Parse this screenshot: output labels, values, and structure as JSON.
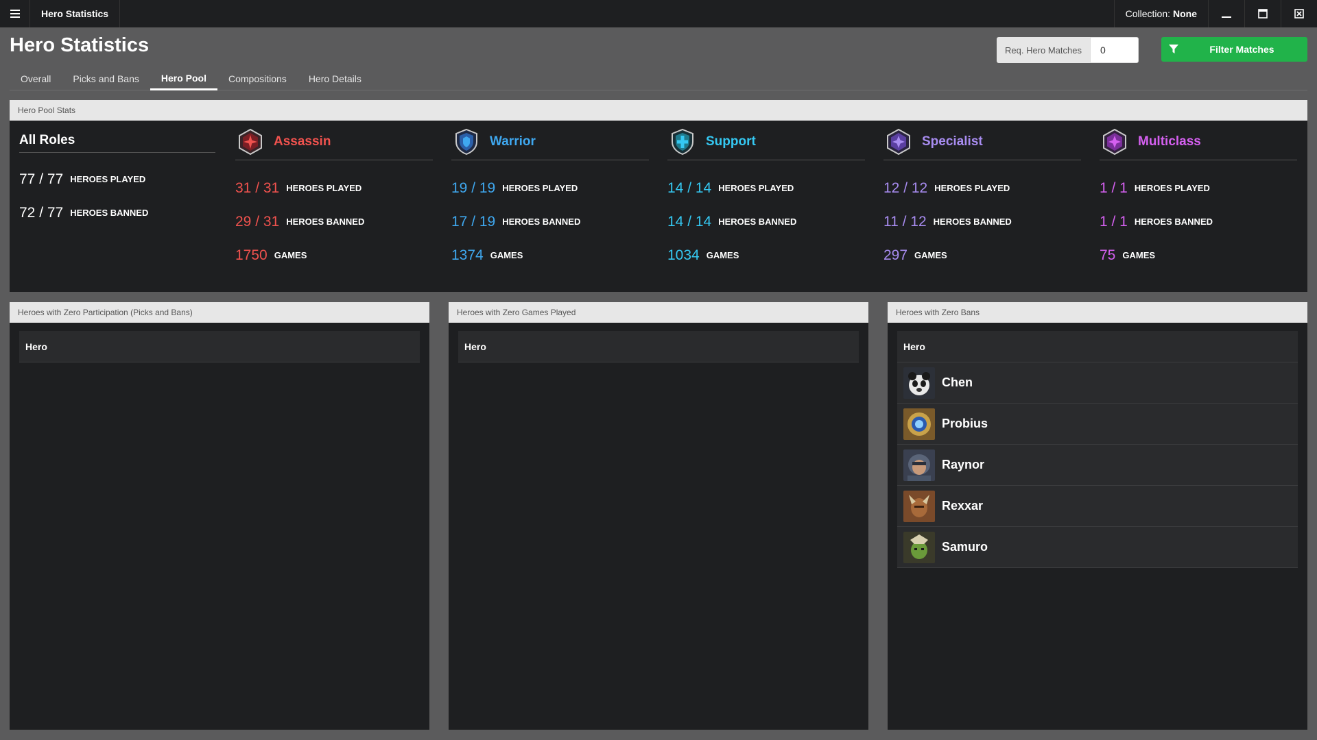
{
  "window": {
    "title": "Hero Statistics",
    "collection_label": "Collection:",
    "collection_value": "None"
  },
  "page": {
    "title": "Hero Statistics",
    "tabs": [
      {
        "label": "Overall"
      },
      {
        "label": "Picks and Bans"
      },
      {
        "label": "Hero Pool"
      },
      {
        "label": "Compositions"
      },
      {
        "label": "Hero Details"
      }
    ],
    "active_tab": "Hero Pool",
    "req_label": "Req. Hero Matches",
    "req_value": "0",
    "filter_label": "Filter Matches"
  },
  "stats_panel": {
    "title": "Hero Pool Stats",
    "all_roles": {
      "title": "All Roles",
      "played": "77 / 77",
      "played_label": "HEROES PLAYED",
      "banned": "72 / 77",
      "banned_label": "HEROES BANNED"
    },
    "roles": [
      {
        "name": "Assassin",
        "color": "#f0524e",
        "icon": "assassin-icon",
        "played": "31 / 31",
        "banned": "29 / 31",
        "games": "1750"
      },
      {
        "name": "Warrior",
        "color": "#3fa8f0",
        "icon": "warrior-icon",
        "played": "19 / 19",
        "banned": "17 / 19",
        "games": "1374"
      },
      {
        "name": "Support",
        "color": "#35c8f2",
        "icon": "support-icon",
        "played": "14 / 14",
        "banned": "14 / 14",
        "games": "1034"
      },
      {
        "name": "Specialist",
        "color": "#a88cf0",
        "icon": "specialist-icon",
        "played": "12 / 12",
        "banned": "11 / 12",
        "games": "297"
      },
      {
        "name": "Multiclass",
        "color": "#d560f0",
        "icon": "multiclass-icon",
        "played": "1 / 1",
        "banned": "1 / 1",
        "games": "75"
      }
    ],
    "labels": {
      "played": "HEROES PLAYED",
      "banned": "HEROES BANNED",
      "games": "GAMES"
    }
  },
  "zero_participation": {
    "title": "Heroes with Zero Participation (Picks and Bans)",
    "column": "Hero",
    "rows": []
  },
  "zero_games": {
    "title": "Heroes with Zero Games Played",
    "column": "Hero",
    "rows": []
  },
  "zero_bans": {
    "title": "Heroes with Zero Bans",
    "column": "Hero",
    "rows": [
      {
        "name": "Chen",
        "avatar": "chen-portrait"
      },
      {
        "name": "Probius",
        "avatar": "probius-portrait"
      },
      {
        "name": "Raynor",
        "avatar": "raynor-portrait"
      },
      {
        "name": "Rexxar",
        "avatar": "rexxar-portrait"
      },
      {
        "name": "Samuro",
        "avatar": "samuro-portrait"
      }
    ]
  }
}
